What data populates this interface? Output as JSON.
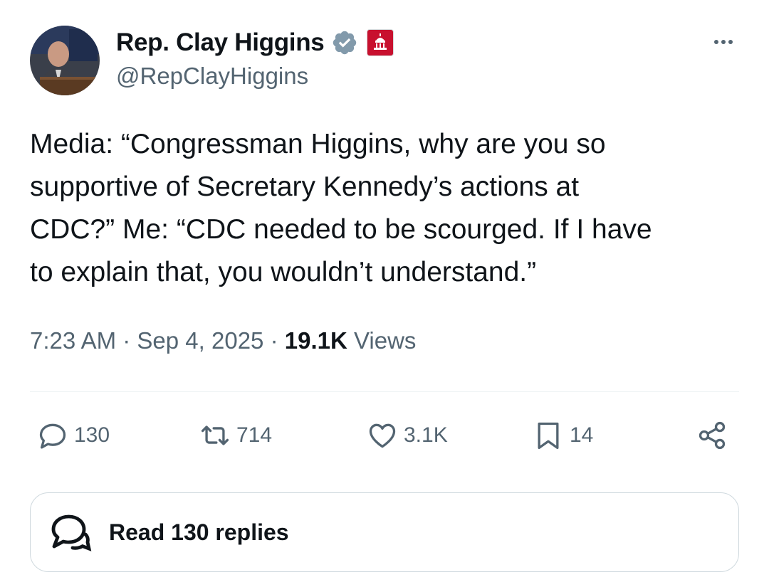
{
  "author": {
    "display_name": "Rep. Clay Higgins",
    "handle": "@RepClayHiggins",
    "verified_badge_color": "#829aab",
    "affiliation_badge_color": "#c8102e"
  },
  "tweet": {
    "text": "Media: “Congressman Higgins, why are you so\nsupportive of Secretary Kennedy’s actions at\nCDC?” Me: “CDC needed to be scourged. If I have\nto explain that, you wouldn’t understand.”",
    "time": "7:23 AM",
    "separator": "·",
    "date": "Sep 4, 2025",
    "views_count": "19.1K",
    "views_label": "Views"
  },
  "actions": {
    "replies": "130",
    "reposts": "714",
    "likes": "3.1K",
    "bookmarks": "14"
  },
  "read_replies_label": "Read 130 replies",
  "icons": [
    "verified-badge-icon",
    "capitol-affiliation-icon",
    "more-icon",
    "reply-icon",
    "repost-icon",
    "like-icon",
    "bookmark-icon",
    "share-icon",
    "speech-bubbles-icon"
  ]
}
